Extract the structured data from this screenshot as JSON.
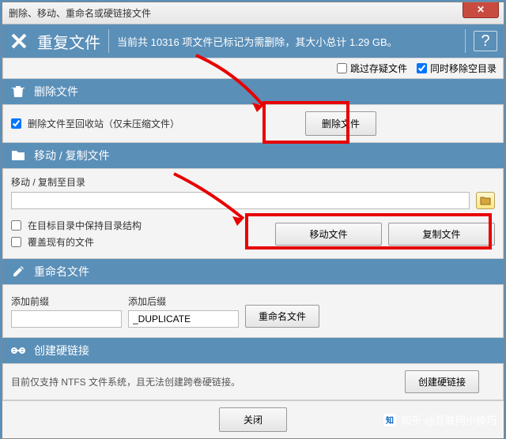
{
  "window": {
    "title": "删除、移动、重命名或硬链接文件"
  },
  "header": {
    "title": "重复文件",
    "info": "当前共 10316 项文件已标记为需删除，其大小总计 1.29 GB。"
  },
  "options": {
    "skip_suspect_label": "跳过存疑文件",
    "remove_empty_label": "同时移除空目录"
  },
  "delete": {
    "header": "删除文件",
    "recycle_label": "删除文件至回收站（仅未压缩文件）",
    "button": "删除文件"
  },
  "move": {
    "header": "移动 / 复制文件",
    "target_label": "移动 / 复制至目录",
    "keep_structure_label": "在目标目录中保持目录结构",
    "overwrite_label": "覆盖现有的文件",
    "move_button": "移动文件",
    "copy_button": "复制文件"
  },
  "rename": {
    "header": "重命名文件",
    "prefix_label": "添加前缀",
    "suffix_label": "添加后缀",
    "suffix_value": "_DUPLICATE",
    "button": "重命名文件"
  },
  "hardlink": {
    "header": "创建硬链接",
    "note": "目前仅支持 NTFS 文件系统，且无法创建跨卷硬链接。",
    "button": "创建硬链接"
  },
  "footer": {
    "close": "关闭"
  },
  "watermark": "知乎 @互联网小技巧"
}
